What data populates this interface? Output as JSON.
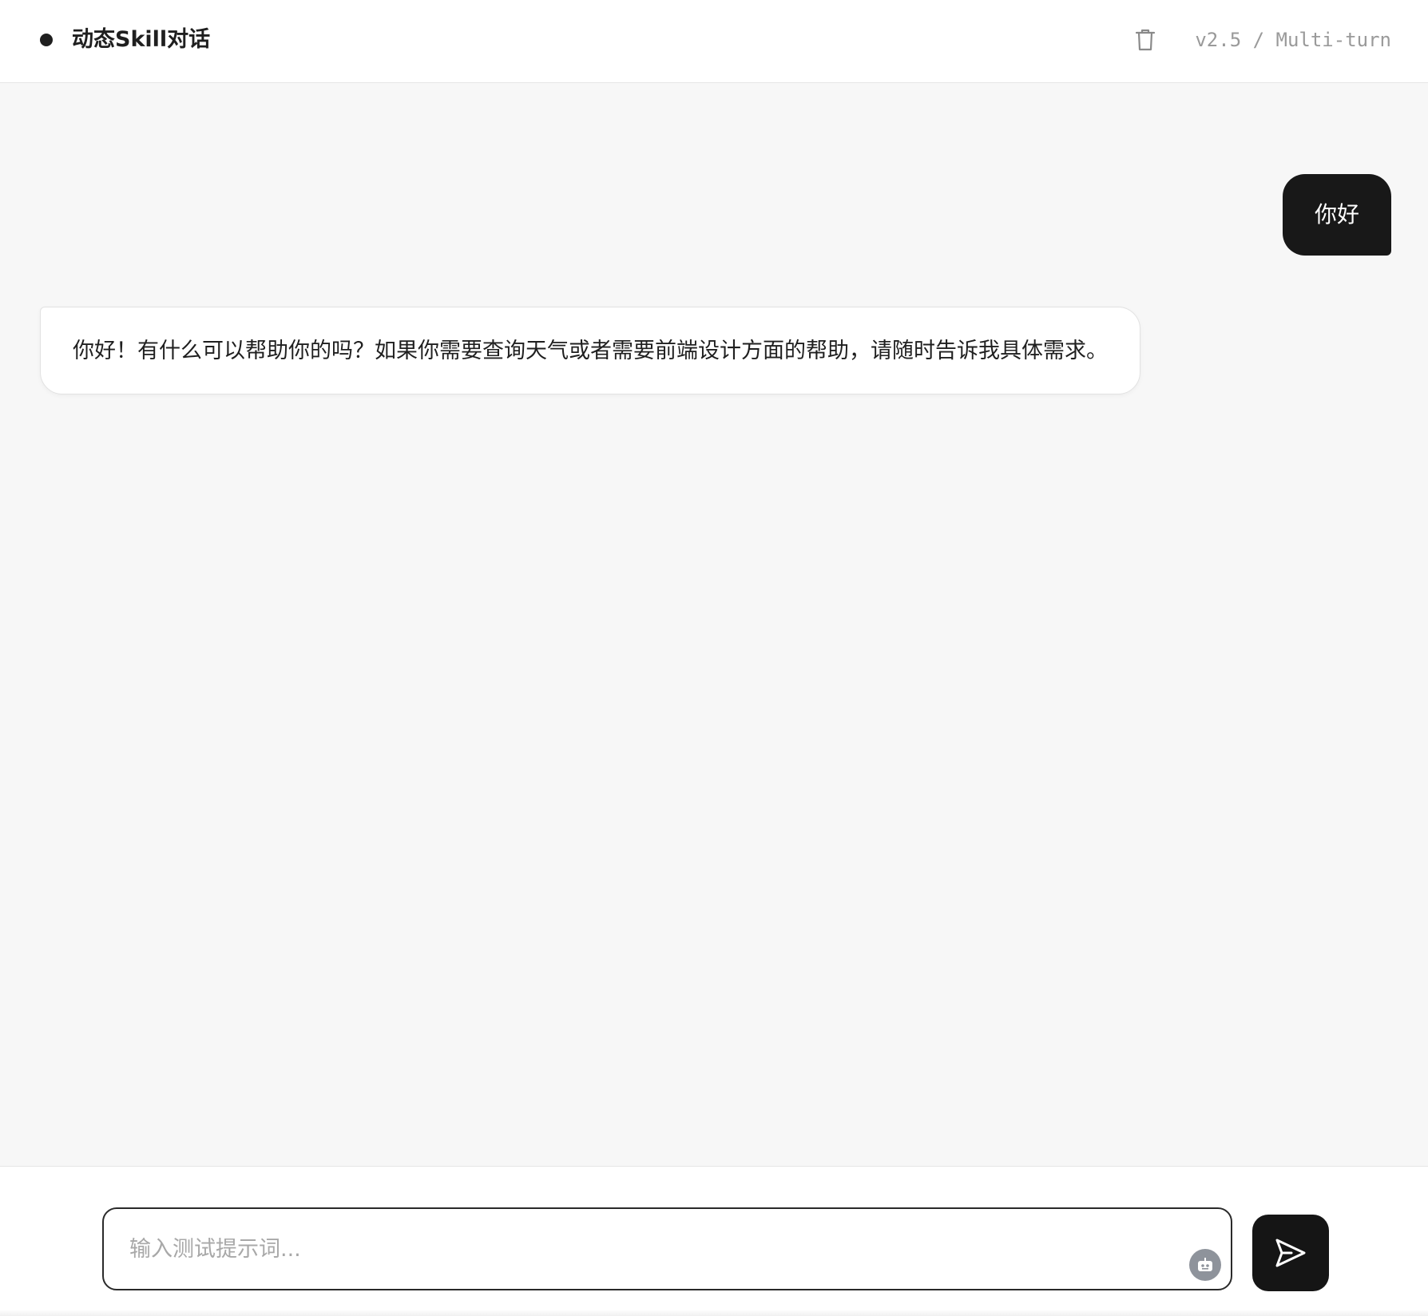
{
  "header": {
    "title": "动态Skill对话",
    "version": "v2.5 / Multi-turn",
    "delete_icon": "trash-icon"
  },
  "messages": [
    {
      "role": "user",
      "text": "你好"
    },
    {
      "role": "assistant",
      "text": "你好！有什么可以帮助你的吗？如果你需要查询天气或者需要前端设计方面的帮助，请随时告诉我具体需求。"
    }
  ],
  "composer": {
    "placeholder": "输入测试提示词...",
    "value": "",
    "agent_icon": "robot-icon",
    "send_icon": "send-icon"
  },
  "colors": {
    "accent": "#151515",
    "background": "#f7f7f7",
    "placeholder": "#a8a8a8",
    "muted": "#9a9a9a"
  }
}
